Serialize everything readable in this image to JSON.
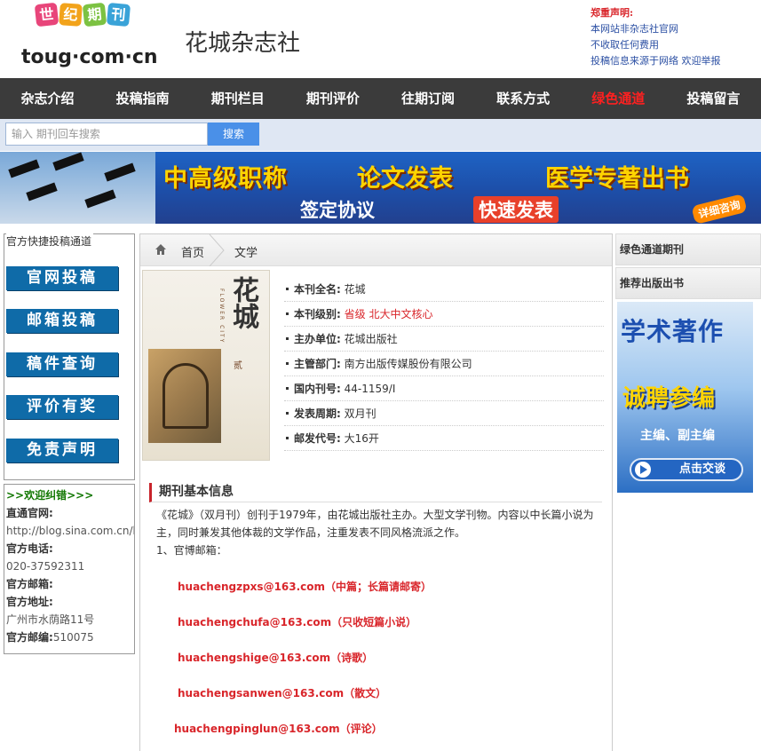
{
  "header": {
    "logo_badges": [
      "世",
      "纪",
      "期",
      "刊"
    ],
    "logo_domain": "toug·com·cn",
    "site_title": "花城杂志社",
    "notice_title": "郑重声明:",
    "notice_lines": [
      "本网站非杂志社官网",
      "不收取任何费用",
      "投稿信息来源于网络 欢迎举报"
    ]
  },
  "nav": {
    "items": [
      "杂志介绍",
      "投稿指南",
      "期刊栏目",
      "期刊评价",
      "往期订阅",
      "联系方式",
      "绿色通道",
      "投稿留言"
    ],
    "highlight_color": "#ff2020"
  },
  "search": {
    "placeholder": "输入 期刊回车搜索",
    "button": "搜索"
  },
  "banner": {
    "line1_a": "中高级职称",
    "line1_b": "论文发表",
    "line1_c": "医学专著出书",
    "line2_a": "签定协议",
    "line2_b": "快速发表",
    "cta": "详细咨询"
  },
  "left": {
    "quick_title": "官方快捷投稿通道",
    "buttons": [
      "官网投稿",
      "邮箱投稿",
      "稿件查询",
      "评价有奖",
      "免责声明"
    ],
    "contact": {
      "title": ">>欢迎纠错>>>",
      "website_label": "直通官网:",
      "website": "http://blog.sina.com.cn/hua",
      "phone_label": "官方电话:",
      "phone": "020-37592311",
      "email_label": "官方邮箱:",
      "address_label": "官方地址:",
      "address": "广州市水荫路11号",
      "zip_label": "官方邮编:",
      "zip": "510075"
    }
  },
  "breadcrumb": {
    "home": "首页",
    "current": "文学"
  },
  "cover": {
    "title": "花城",
    "subtitle": "FLOWER CITY",
    "mark": "贰"
  },
  "info": [
    {
      "label": "本刊全名:",
      "value": "花城",
      "red": false
    },
    {
      "label": "本刊级别:",
      "value": "省级 北大中文核心",
      "red": true
    },
    {
      "label": "主办单位:",
      "value": "花城出版社",
      "red": false
    },
    {
      "label": "主管部门:",
      "value": "南方出版传媒股份有限公司",
      "red": false
    },
    {
      "label": "国内刊号:",
      "value": " 44-1159/I",
      "red": false
    },
    {
      "label": "发表周期:",
      "value": "双月刊",
      "red": false
    },
    {
      "label": "邮发代号:",
      "value": "大16开",
      "red": false
    }
  ],
  "section": {
    "title": "期刊基本信息",
    "intro": "《花城》（双月刊）创刊于1979年，由花城出版社主办。大型文学刊物。内容以中长篇小说为主，同时兼发其他体裁的文学作品，注重发表不同风格流派之作。",
    "emails_heading": "1、官博邮箱：",
    "emails": [
      "huachengzpxs@163.com（中篇；长篇请邮寄）",
      "huachengchufa@163.com（只收短篇小说）",
      "huachengshige@163.com（诗歌）",
      "huachengsanwen@163.com（散文）",
      "huachengpinglun@163.com（评论）"
    ]
  },
  "right": {
    "green_title": "绿色通道期刊",
    "recommend_title": "推荐出版出书",
    "ad_line1": "学术著作",
    "ad_line2": "诚聘参编",
    "ad_line3": "主编、副主编",
    "ad_cta": "点击交谈"
  }
}
